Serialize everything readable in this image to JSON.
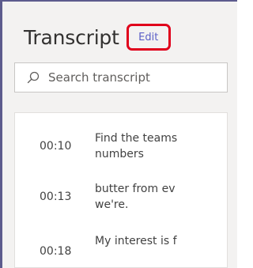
{
  "panel": {
    "title": "Transcript",
    "edit_label": "Edit"
  },
  "search": {
    "placeholder": "Search transcript",
    "icon": "search-icon"
  },
  "entries": [
    {
      "time": "00:10",
      "line1": "Find the teams",
      "line2": "numbers"
    },
    {
      "time": "00:13",
      "line1": "butter from ev",
      "line2": "we're."
    },
    {
      "time": "00:18",
      "line1": "My interest is f",
      "line2": ""
    }
  ],
  "colors": {
    "accent": "#5b5fc7",
    "highlight_border": "#e0001b",
    "panel_bg": "#f3f2f1",
    "frame_border": "#5c5b8d"
  }
}
